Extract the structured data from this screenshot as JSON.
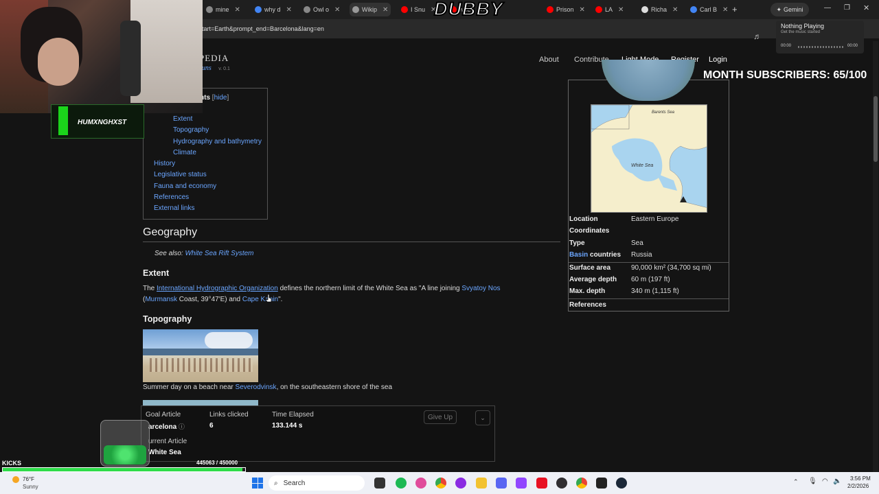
{
  "browser": {
    "tabs": [
      {
        "label": "mine",
        "favicon": "chatgpt-icon",
        "color": "#888"
      },
      {
        "label": "why d",
        "favicon": "google-icon",
        "color": "#4285f4"
      },
      {
        "label": "Owl o",
        "favicon": "chatgpt-icon",
        "color": "#888"
      },
      {
        "label": "Wikip",
        "favicon": "wiki-icon",
        "color": "#999"
      },
      {
        "label": "I Snu",
        "favicon": "youtube-icon",
        "color": "#ff0000"
      },
      {
        "label": "when",
        "favicon": "youtube-icon",
        "color": "#ff0000"
      },
      {
        "label": "Prison",
        "favicon": "youtube-icon",
        "color": "#ff0000"
      },
      {
        "label": "LA",
        "favicon": "youtube-icon",
        "color": "#ff0000"
      },
      {
        "label": "Richa",
        "favicon": "wikipedia-icon",
        "color": "#ddd"
      },
      {
        "label": "Carl B",
        "favicon": "google-icon",
        "color": "#4285f4"
      }
    ],
    "gemini_label": "Gemini",
    "url": "tart=Earth&prompt_end=Barcelona&lang=en"
  },
  "site": {
    "logo_text": "PEDIA",
    "logo_sub": "runs",
    "version": "v. 0.1",
    "nav": [
      "About",
      "Contribute",
      "Light Mode",
      "Register",
      "Login"
    ]
  },
  "toc": {
    "title": "nts",
    "hide_label": "hide",
    "items": [
      {
        "label": "Extent",
        "indent": true
      },
      {
        "label": "Topography",
        "indent": true
      },
      {
        "label": "Hydrography and bathymetry",
        "indent": true
      },
      {
        "label": "Climate",
        "indent": true
      },
      {
        "label": "History",
        "indent": false
      },
      {
        "label": "Legislative status",
        "indent": false
      },
      {
        "label": "Fauna and economy",
        "indent": false
      },
      {
        "label": "References",
        "indent": false
      },
      {
        "label": "External links",
        "indent": false
      }
    ]
  },
  "article": {
    "geography_heading": "Geography",
    "see_also_prefix": "See also:",
    "see_also_link": "White Sea Rift System",
    "extent_heading": "Extent",
    "extent_p1_pre": "The ",
    "extent_p1_link1": "International Hydrographic Organization",
    "extent_p1_mid": " defines the northern limit of the White Sea as \"A line joining ",
    "extent_p1_link2": "Svyatoy Nos",
    "extent_p2_pre": "(",
    "extent_p2_link1": "Murmansk",
    "extent_p2_mid": " Coast, 39°47′E) and ",
    "extent_p2_link2": "Cape Kanin",
    "extent_p2_end": "\".",
    "topo_heading": "Topography",
    "caption_pre": "Summer day on a beach near ",
    "caption_link": "Severodvinsk",
    "caption_post": ", on the southeastern shore of the sea"
  },
  "infobox": {
    "map_labels": {
      "barents": "Barents Sea",
      "white": "White Sea"
    },
    "rows": [
      {
        "label": "Location",
        "value": "Eastern Europe",
        "value_link": true
      },
      {
        "label": "Coordinates",
        "value": ""
      },
      {
        "label": "Type",
        "value": "Sea",
        "label_link": true,
        "value_link": true
      },
      {
        "label": "Basin",
        "label_suffix": " countries",
        "value": "Russia",
        "label_link": true,
        "value_link": true
      },
      {
        "label": "Surface area",
        "value": "90,000 km² (34,700 sq mi)"
      },
      {
        "label": "Average depth",
        "value": "60 m (197 ft)"
      },
      {
        "label": "Max. depth",
        "value": "340 m (1,115 ft)"
      },
      {
        "label": "References",
        "value": ""
      }
    ]
  },
  "game": {
    "goal_label": "Goal Article",
    "goal_value": "arcelona",
    "links_label": "Links clicked",
    "links_value": "6",
    "time_label": "Time Elapsed",
    "time_value": "133.144 s",
    "give_up": "Give Up",
    "current_label": "urrent Article",
    "current_value": "White Sea"
  },
  "stream": {
    "logo": "DUBBY",
    "streamer_name": "HUMXNGHXST",
    "subs": "MONTH SUBSCRIBERS: 65/100",
    "kicks_label": "KICKS",
    "kicks_progress": "445063 / 450000",
    "progress_fraction": 0.989,
    "music_title": "Nothing Playing",
    "music_sub": "Get the music started",
    "music_t0": "00:00",
    "music_t1": "00:00"
  },
  "taskbar": {
    "weather_temp": "76°F",
    "weather_desc": "Sunny",
    "search_label": "Search",
    "time": "3:56 PM",
    "date": "2/2/2026"
  }
}
